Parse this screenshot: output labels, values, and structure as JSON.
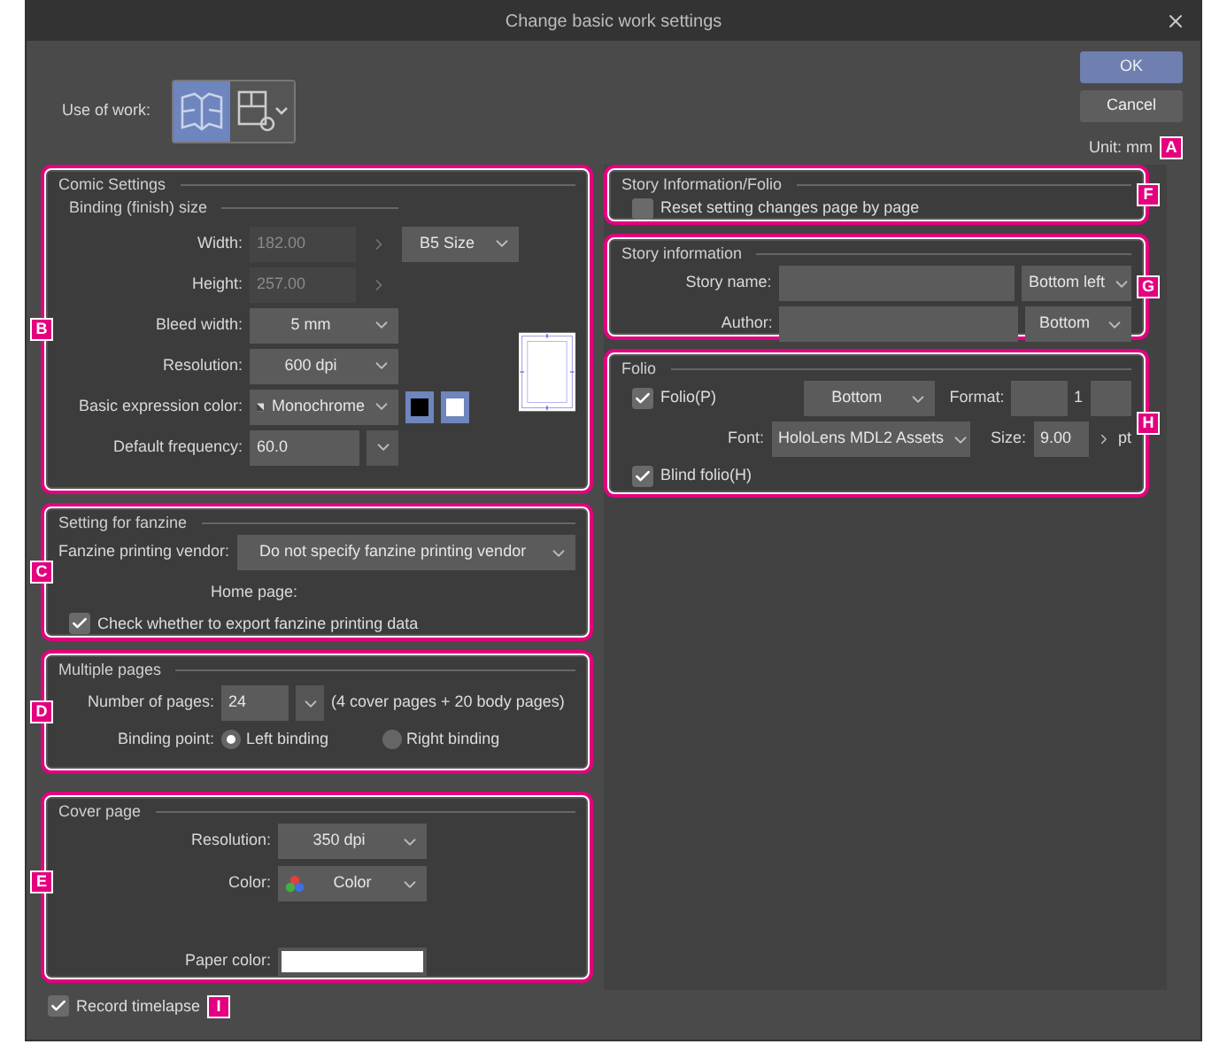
{
  "window": {
    "title": "Change basic work settings"
  },
  "use_of_work": {
    "label": "Use of work:",
    "options": [
      {
        "kind": "comic",
        "selected": true
      },
      {
        "kind": "settings",
        "selected": false
      }
    ]
  },
  "buttons": [
    {
      "label": "OK",
      "kind": "primary"
    },
    {
      "label": "Cancel",
      "kind": "secondary"
    }
  ],
  "unit": {
    "label": "Unit:",
    "value": "mm",
    "callout": "A"
  },
  "comic_settings": {
    "title": "Comic Settings",
    "callout": "B",
    "binding_title": "Binding (finish) size",
    "width": {
      "label": "Width:",
      "value": "182.00",
      "disabled": true
    },
    "height": {
      "label": "Height:",
      "value": "257.00",
      "disabled": true
    },
    "size_preset": "B5 Size",
    "bleed_width": {
      "label": "Bleed width:",
      "value": "5 mm"
    },
    "resolution": {
      "label": "Resolution:",
      "value": "600 dpi"
    },
    "expression_color": {
      "label": "Basic expression color:",
      "value": "Monochrome",
      "swatches": [
        {
          "color": "#000000"
        },
        {
          "color": "#ffffff"
        }
      ]
    },
    "default_frequency": {
      "label": "Default frequency:",
      "value": "60.0"
    }
  },
  "fanzine": {
    "title": "Setting for fanzine",
    "callout": "C",
    "vendor": {
      "label": "Fanzine printing vendor:",
      "value": "Do not specify fanzine printing vendor"
    },
    "home_page_label": "Home page:",
    "export_check": {
      "label": "Check whether to export fanzine printing data",
      "checked": true
    }
  },
  "multiple_pages": {
    "title": "Multiple pages",
    "callout": "D",
    "pages": {
      "label": "Number of pages:",
      "value": "24",
      "note": "(4 cover pages + 20 body pages)"
    },
    "binding_point": {
      "label": "Binding point:",
      "options": [
        {
          "label": "Left binding",
          "selected": true
        },
        {
          "label": "Right binding",
          "selected": false
        }
      ]
    }
  },
  "cover_page": {
    "title": "Cover page",
    "callout": "E",
    "resolution": {
      "label": "Resolution:",
      "value": "350 dpi"
    },
    "color": {
      "label": "Color:",
      "value": "Color"
    },
    "paper_color": {
      "label": "Paper color:",
      "color": "#ffffff"
    }
  },
  "record_timelapse": {
    "label": "Record timelapse",
    "checked": true,
    "callout": "I"
  },
  "story_folio": {
    "title": "Story Information/Folio",
    "callout": "F",
    "reset": {
      "label": "Reset setting changes page by page",
      "checked": false
    }
  },
  "story_info": {
    "title": "Story information",
    "callout": "G",
    "fields": [
      {
        "label": "Story name:",
        "position": "Bottom left"
      },
      {
        "label": "Author:",
        "position": "Bottom"
      }
    ]
  },
  "folio": {
    "title": "Folio",
    "callout": "H",
    "folio_check": {
      "label": "Folio(P)",
      "checked": true
    },
    "position": "Bottom",
    "format_label": "Format:",
    "format_number": "1",
    "font": {
      "label": "Font:",
      "value": "HoloLens MDL2 Assets"
    },
    "size": {
      "label": "Size:",
      "value": "9.00",
      "unit": "pt"
    },
    "blind_folio": {
      "label": "Blind folio(H)",
      "checked": true
    }
  }
}
